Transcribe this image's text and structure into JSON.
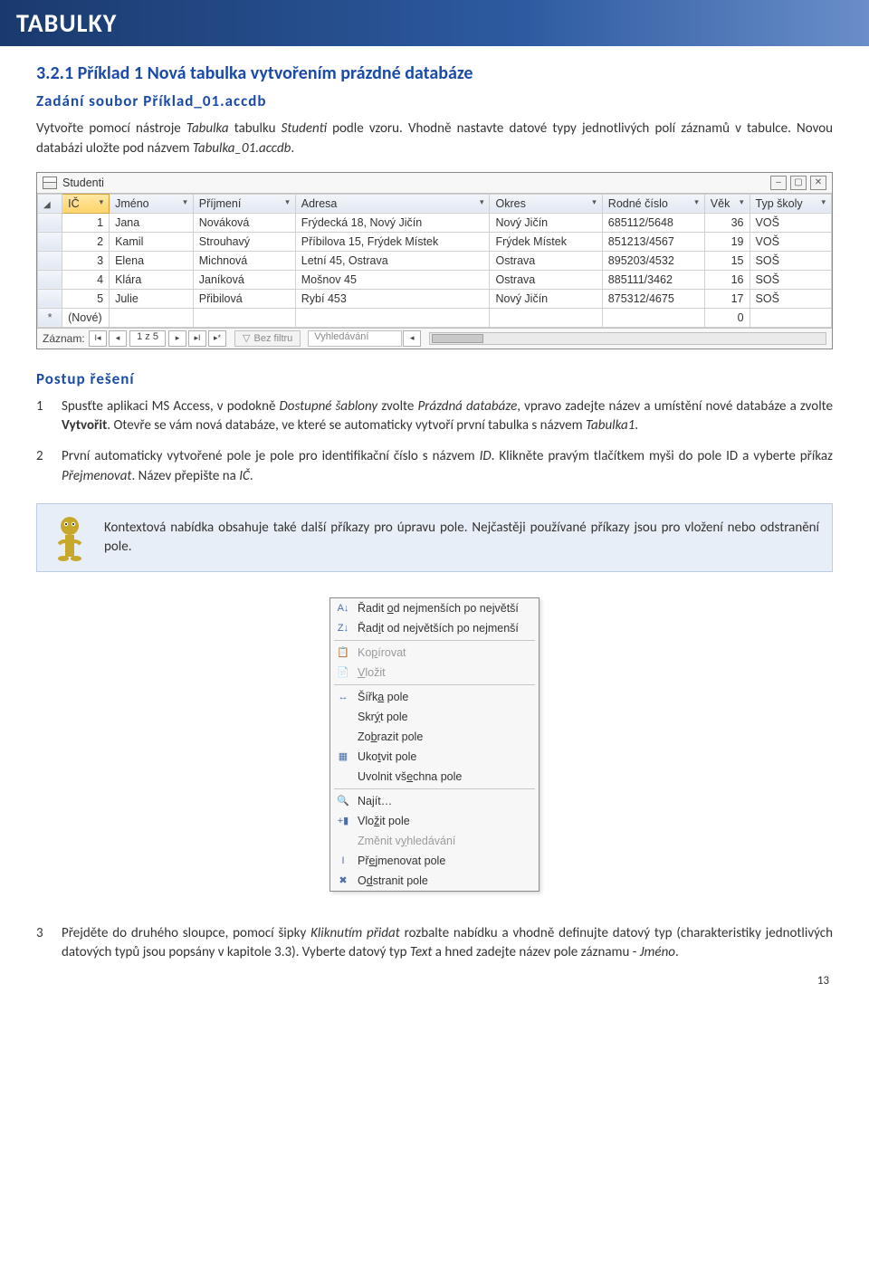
{
  "banner": "TABULKY",
  "section_heading": "3.2.1  Příklad 1 Nová tabulka vytvořením prázdné databáze",
  "task_heading": "Zadání  soubor Příklad_01.accdb",
  "task_para_parts": {
    "a": "Vytvořte pomocí nástroje ",
    "b": "Tabulka",
    "c": " tabulku ",
    "d": "Studenti",
    "e": " podle vzoru. Vhodně nastavte datové typy jednotlivých polí záznamů v tabulce. Novou databázi uložte pod názvem ",
    "f": "Tabulka_01.accdb",
    "g": "."
  },
  "datasheet": {
    "title": "Studenti",
    "window_buttons": {
      "min": "–",
      "max": "▢",
      "close": "✕"
    },
    "columns": [
      "IČ",
      "Jméno",
      "Příjmení",
      "Adresa",
      "Okres",
      "Rodné číslo",
      "Věk",
      "Typ školy"
    ],
    "rows": [
      {
        "ic": "1",
        "jm": "Jana",
        "pr": "Nováková",
        "ad": "Frýdecká 18, Nový Jičín",
        "ok": "Nový Jičín",
        "rc": "685112/5648",
        "vek": "36",
        "typ": "VOŠ"
      },
      {
        "ic": "2",
        "jm": "Kamil",
        "pr": "Strouhavý",
        "ad": "Příbilova 15, Frýdek Místek",
        "ok": "Frýdek Místek",
        "rc": "851213/4567",
        "vek": "19",
        "typ": "VOŠ"
      },
      {
        "ic": "3",
        "jm": "Elena",
        "pr": "Michnová",
        "ad": "Letní 45, Ostrava",
        "ok": "Ostrava",
        "rc": "895203/4532",
        "vek": "15",
        "typ": "SOŠ"
      },
      {
        "ic": "4",
        "jm": "Klára",
        "pr": "Janíková",
        "ad": "Mošnov 45",
        "ok": "Ostrava",
        "rc": "885111/3462",
        "vek": "16",
        "typ": "SOŠ"
      },
      {
        "ic": "5",
        "jm": "Julie",
        "pr": "Přibilová",
        "ad": "Rybí 453",
        "ok": "Nový Jičín",
        "rc": "875312/4675",
        "vek": "17",
        "typ": "SOŠ"
      }
    ],
    "new_row": {
      "label": "(Nové)",
      "vek": "0"
    },
    "footer": {
      "record_label": "Záznam:",
      "position": "1 z 5",
      "filter_label": "Bez filtru",
      "search_placeholder": "Vyhledávání"
    }
  },
  "proc_heading": "Postup řešení",
  "steps": {
    "1": {
      "num": "1",
      "a": "Spusťte aplikaci MS Access, v podokně ",
      "b": "Dostupné šablony",
      "c": " zvolte ",
      "d": "Prázdná databáze",
      "e": ", vpravo zadejte název a umístění nové databáze a zvolte ",
      "f": "Vytvořit",
      "g": ". Otevře se vám nová databáze, ve které se automaticky vytvoří první tabulka s názvem ",
      "h": "Tabulka1",
      "i": "."
    },
    "2": {
      "num": "2",
      "a": "První automaticky vytvořené pole je pole pro identifikační číslo s názvem ",
      "b": "ID",
      "c": ". Klikněte pravým tlačítkem myši do pole ID a vyberte příkaz ",
      "d": "Přejmenovat",
      "e": ". Název přepište na ",
      "f": "IČ",
      "g": "."
    },
    "3": {
      "num": "3",
      "a": "Přejděte do druhého sloupce, pomocí šipky ",
      "b": "Kliknutím přidat",
      "c": " rozbalte nabídku a vhodně definujte datový typ (charakteristiky jednotlivých datových typů jsou popsány v kapitole 3.3). Vyberte datový typ ",
      "d": "Text",
      "e": " a hned zadejte název pole záznamu - ",
      "f": "Jméno",
      "g": "."
    }
  },
  "note": "Kontextová nabídka obsahuje také další příkazy pro úpravu pole. Nejčastěji používané příkazy jsou pro vložení nebo odstranění pole.",
  "context_menu": [
    {
      "icon": "A↓",
      "label": "Řadit od nejmenších po největší",
      "disabled": false,
      "sep": false,
      "u": "o"
    },
    {
      "icon": "Z↓",
      "label": "Řadit od největších po nejmenší",
      "disabled": false,
      "sep": false,
      "u": "i"
    },
    {
      "sep": true
    },
    {
      "icon": "📋",
      "label": "Kopírovat",
      "disabled": true,
      "sep": false,
      "u": "p"
    },
    {
      "icon": "📄",
      "label": "Vložit",
      "disabled": true,
      "sep": false,
      "u": "V"
    },
    {
      "sep": true
    },
    {
      "icon": "↔",
      "label": "Šířka pole",
      "disabled": false,
      "sep": false,
      "u": "a"
    },
    {
      "icon": "",
      "label": "Skrýt pole",
      "disabled": false,
      "sep": false,
      "u": "ý"
    },
    {
      "icon": "",
      "label": "Zobrazit pole",
      "disabled": false,
      "sep": false,
      "u": "b"
    },
    {
      "icon": "▦",
      "label": "Ukotvit pole",
      "disabled": false,
      "sep": false,
      "u": "t"
    },
    {
      "icon": "",
      "label": "Uvolnit všechna pole",
      "disabled": false,
      "sep": false,
      "u": "e"
    },
    {
      "sep": true
    },
    {
      "icon": "🔍",
      "label": "Najít…",
      "disabled": false,
      "sep": false,
      "u": "j"
    },
    {
      "icon": "+▮",
      "label": "Vložit pole",
      "disabled": false,
      "sep": false,
      "u": "ž"
    },
    {
      "icon": "",
      "label": "Změnit vyhledávání",
      "disabled": true,
      "sep": false,
      "u": "y"
    },
    {
      "icon": "I",
      "label": "Přejmenovat pole",
      "disabled": false,
      "sep": false,
      "u": "e"
    },
    {
      "icon": "✖",
      "label": "Odstranit pole",
      "disabled": false,
      "sep": false,
      "u": "d"
    }
  ],
  "page_number": "13"
}
